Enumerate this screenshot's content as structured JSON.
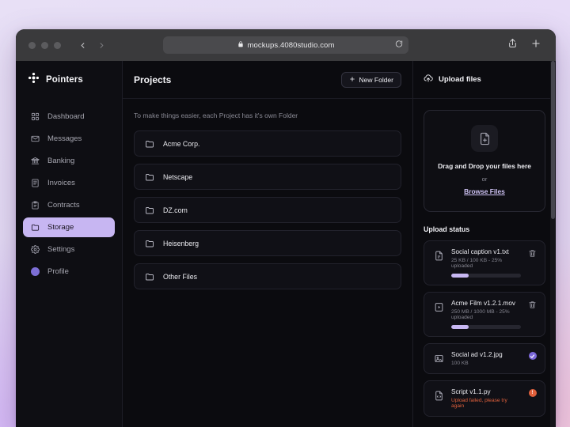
{
  "browser": {
    "url": "mockups.4080studio.com",
    "lock_icon": "lock-icon",
    "reload_icon": "reload-icon",
    "back_icon": "chevron-left-icon",
    "forward_icon": "chevron-right-icon",
    "share_icon": "share-icon",
    "new_tab_icon": "plus-icon"
  },
  "sidebar": {
    "brand": "Pointers",
    "items": [
      {
        "label": "Dashboard",
        "icon": "grid-icon",
        "active": false
      },
      {
        "label": "Messages",
        "icon": "envelope-icon",
        "active": false
      },
      {
        "label": "Banking",
        "icon": "bank-icon",
        "active": false
      },
      {
        "label": "Invoices",
        "icon": "invoice-icon",
        "active": false
      },
      {
        "label": "Contracts",
        "icon": "clipboard-icon",
        "active": false
      },
      {
        "label": "Storage",
        "icon": "folder-icon",
        "active": true
      },
      {
        "label": "Settings",
        "icon": "gear-icon",
        "active": false
      },
      {
        "label": "Profile",
        "icon": "avatar-icon",
        "active": false
      }
    ]
  },
  "projects": {
    "title": "Projects",
    "new_folder_label": "New Folder",
    "subtitle": "To make things easier, each Project has it's own Folder",
    "folders": [
      {
        "name": "Acme Corp."
      },
      {
        "name": "Netscape"
      },
      {
        "name": "DZ.com"
      },
      {
        "name": "Heisenberg"
      },
      {
        "name": "Other Files"
      }
    ]
  },
  "upload": {
    "title": "Upload files",
    "dropzone": {
      "title": "Drag and Drop your files here",
      "or": "or",
      "browse": "Browse Files"
    },
    "status_title": "Upload status",
    "files": [
      {
        "name": "Social caption v1.txt",
        "meta": "25 KB / 100 KB - 25% uploaded",
        "icon": "document-icon",
        "progress": 25,
        "state": "uploading",
        "action": "trash-icon"
      },
      {
        "name": "Acme Film v1.2.1.mov",
        "meta": "250 MB / 1000 MB - 25% uploaded",
        "icon": "video-icon",
        "progress": 25,
        "state": "uploading",
        "action": "trash-icon"
      },
      {
        "name": "Social ad v1.2.jpg",
        "meta": "100 KB",
        "icon": "image-icon",
        "progress": 100,
        "state": "complete",
        "action": "check-badge"
      },
      {
        "name": "Script v1.1.py",
        "meta": "Upload failed, please try again",
        "icon": "code-file-icon",
        "progress": 0,
        "state": "error",
        "action": "error-badge"
      }
    ]
  },
  "colors": {
    "accent": "#c7b6f2",
    "error": "#e0603c",
    "success": "#7b68d9",
    "surface": "#101016",
    "background": "#0b0b0f"
  }
}
